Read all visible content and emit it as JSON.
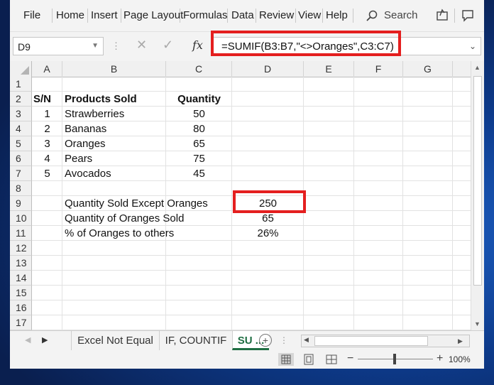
{
  "menu": {
    "items": [
      "File",
      "Home",
      "Insert",
      "Page Layout",
      "Formulas",
      "Data",
      "Review",
      "View",
      "Help"
    ],
    "search_label": "Search",
    "search_icon": "search-icon",
    "share_icon": "share-icon",
    "comments_icon": "comment-icon"
  },
  "formula_bar": {
    "name_box": "D9",
    "fx_label": "fx",
    "formula": "=SUMIF(B3:B7,\"<>Oranges\",C3:C7)",
    "highlight_color": "#e41f1f"
  },
  "grid": {
    "columns": [
      "A",
      "B",
      "C",
      "D",
      "E",
      "F",
      "G"
    ],
    "rows": [
      "1",
      "2",
      "3",
      "4",
      "5",
      "6",
      "7",
      "8",
      "9",
      "10",
      "11",
      "12",
      "13",
      "14",
      "15",
      "16",
      "17"
    ],
    "header": {
      "sn": "S/N",
      "product": "Products Sold",
      "quantity": "Quantity"
    },
    "items": [
      {
        "sn": "1",
        "product": "Strawberries",
        "quantity": "50"
      },
      {
        "sn": "2",
        "product": "Bananas",
        "quantity": "80"
      },
      {
        "sn": "3",
        "product": "Oranges",
        "quantity": "65"
      },
      {
        "sn": "4",
        "product": "Pears",
        "quantity": "75"
      },
      {
        "sn": "5",
        "product": "Avocados",
        "quantity": "45"
      }
    ],
    "summary": [
      {
        "label": "Quantity Sold Except Oranges",
        "value": "250"
      },
      {
        "label": "Quantity of Oranges Sold",
        "value": "65"
      },
      {
        "label": "% of Oranges to others",
        "value": "26%"
      }
    ]
  },
  "tabs": {
    "sheets": [
      "Excel Not Equal",
      "IF, COUNTIF",
      "SU ..."
    ],
    "active_index": 2,
    "add_label": "+",
    "accent": "#1f6e43"
  },
  "status": {
    "zoom_level": "100%"
  }
}
